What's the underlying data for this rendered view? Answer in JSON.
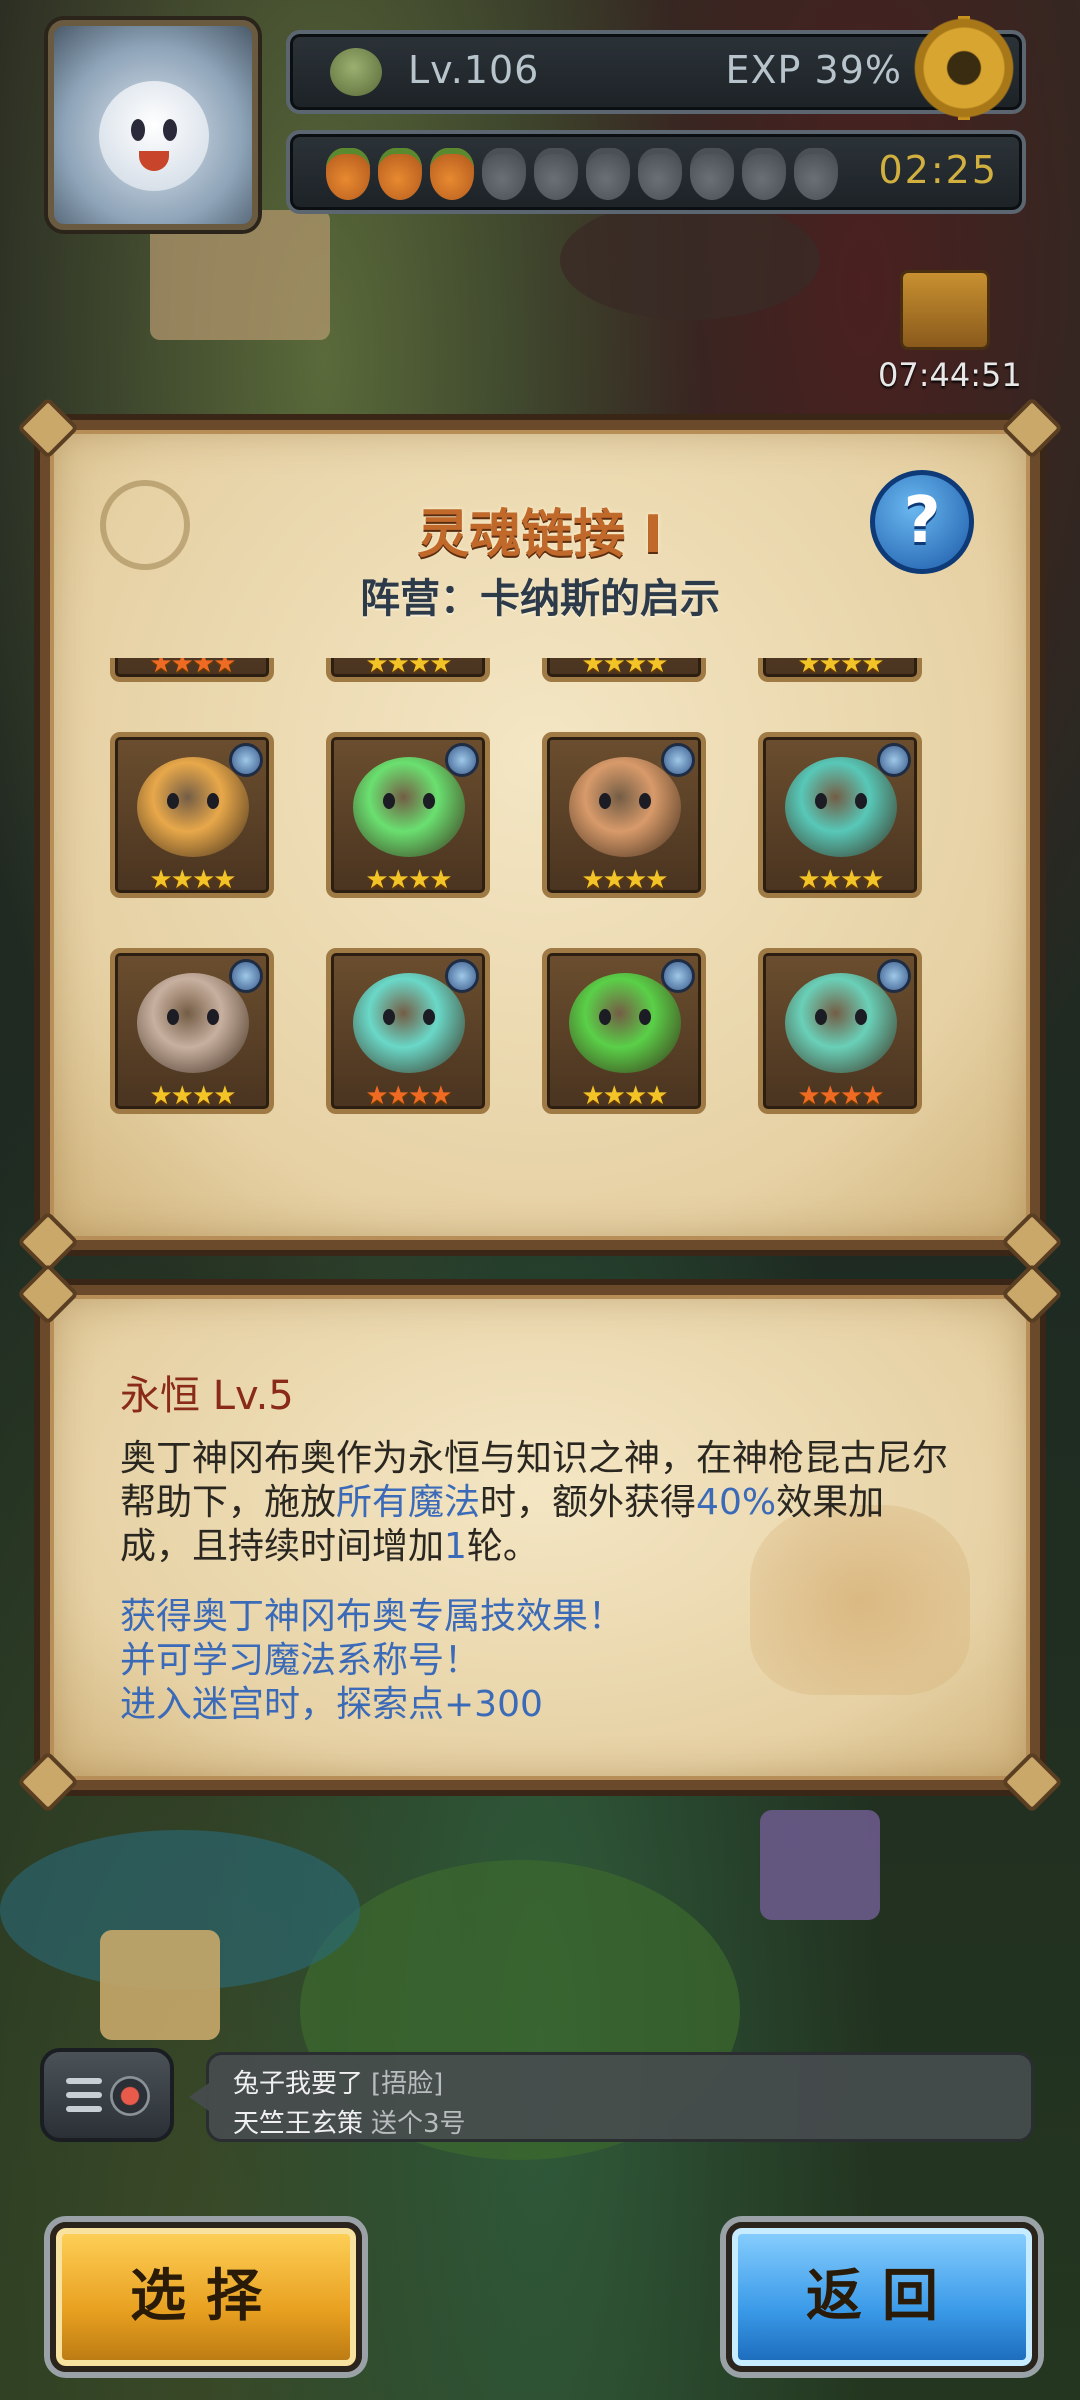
{
  "hud": {
    "level": "Lv.106",
    "exp": "EXP 39%",
    "stamina_icons": [
      "carrot-full",
      "carrot-full",
      "carrot-full",
      "carrot-empty",
      "carrot-empty",
      "carrot-empty",
      "carrot-empty",
      "carrot-empty",
      "carrot-empty",
      "carrot-empty"
    ],
    "stamina_timer": "02:25",
    "chest_timer": "07:44:51"
  },
  "soul_link": {
    "title": "灵魂链接 I",
    "faction": "阵营：卡纳斯的启示",
    "heroes": [
      {
        "stars": "★★★★",
        "star_color": "red",
        "color": "#6ad0c0"
      },
      {
        "stars": "★★★★",
        "star_color": "gold",
        "color": "#e89a3a"
      },
      {
        "stars": "★★★★",
        "star_color": "gold",
        "color": "#7ad8d0"
      },
      {
        "stars": "★★★★",
        "star_color": "gold",
        "color": "#6ad0c0"
      },
      {
        "stars": "★★★★",
        "star_color": "gold",
        "color": "#e8a84a"
      },
      {
        "stars": "★★★★",
        "star_color": "gold",
        "color": "#6ae070"
      },
      {
        "stars": "★★★★",
        "star_color": "gold",
        "color": "#d89a6a"
      },
      {
        "stars": "★★★★",
        "star_color": "gold",
        "color": "#58c8b8"
      },
      {
        "stars": "★★★★",
        "star_color": "gold",
        "color": "#c8b0a0"
      },
      {
        "stars": "★★★★",
        "star_color": "red",
        "color": "#6ad8c8"
      },
      {
        "stars": "★★★★",
        "star_color": "gold",
        "color": "#5ad048"
      },
      {
        "stars": "★★★★",
        "star_color": "red",
        "color": "#6ad0b8"
      }
    ]
  },
  "skill": {
    "name": "永恒 Lv.5",
    "desc_1": "奥丁神冈布奥作为永恒与知识之神，在神枪昆古尼尔帮助下，施放",
    "desc_hl_1": "所有魔法",
    "desc_2": "时，额外获得",
    "desc_hl_2": "40%",
    "desc_3": "效果加成，且持续时间增加",
    "desc_hl_3": "1",
    "desc_4": "轮。",
    "bonus": [
      "获得奥丁神冈布奥专属技效果！",
      "并可学习魔法系称号！",
      "进入迷宫时，探索点+300"
    ]
  },
  "chat": {
    "line1_text": "兔子我要了",
    "line1_tag": "[捂脸]",
    "line2_name": "天竺王玄策",
    "line2_text": "送个3号"
  },
  "buttons": {
    "select": "选择",
    "back": "返回"
  }
}
